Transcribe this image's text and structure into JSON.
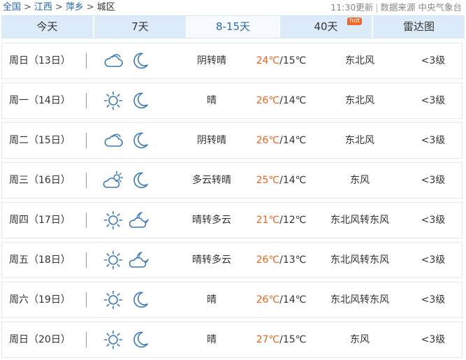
{
  "breadcrumb": {
    "items": [
      "全国",
      "江西",
      "萍乡"
    ],
    "current": "城区",
    "separator": ">"
  },
  "meta": {
    "update_time": "11:30更新",
    "source": "数据来源 中央气象台",
    "divider": "|"
  },
  "tabs": [
    {
      "label": "今天",
      "active": false,
      "badge": ""
    },
    {
      "label": "7天",
      "active": false,
      "badge": ""
    },
    {
      "label": "8-15天",
      "active": true,
      "badge": ""
    },
    {
      "label": "40天",
      "active": false,
      "badge": "hot"
    },
    {
      "label": "雷达图",
      "active": false,
      "badge": ""
    }
  ],
  "colors": {
    "accent": "#2b6db0",
    "high_temp": "#e8641e",
    "icon": "#3a7ab8",
    "badge": "#f06a2c"
  },
  "forecast": [
    {
      "day": "周日（13日）",
      "day_icon": "cloudy-icon",
      "night_icon": "moon-icon",
      "condition": "阴转晴",
      "high": "24℃",
      "low": "/15℃",
      "wind": "东北风",
      "level": "<3级"
    },
    {
      "day": "周一（14日）",
      "day_icon": "sun-icon",
      "night_icon": "moon-icon",
      "condition": "晴",
      "high": "26℃",
      "low": "/14℃",
      "wind": "东北风",
      "level": "<3级"
    },
    {
      "day": "周二（15日）",
      "day_icon": "cloudy-icon",
      "night_icon": "moon-icon",
      "condition": "阴转晴",
      "high": "26℃",
      "low": "/14℃",
      "wind": "东北风",
      "level": "<3级"
    },
    {
      "day": "周三（16日）",
      "day_icon": "partly-cloudy-icon",
      "night_icon": "moon-icon",
      "condition": "多云转晴",
      "high": "25℃",
      "low": "/14℃",
      "wind": "东风",
      "level": "<3级"
    },
    {
      "day": "周四（17日）",
      "day_icon": "sun-icon",
      "night_icon": "cloudy-night-icon",
      "condition": "晴转多云",
      "high": "21℃",
      "low": "/12℃",
      "wind": "东北风转东风",
      "level": "<3级"
    },
    {
      "day": "周五（18日）",
      "day_icon": "sun-icon",
      "night_icon": "cloudy-night-icon",
      "condition": "晴转多云",
      "high": "26℃",
      "low": "/13℃",
      "wind": "东北风转东风",
      "level": "<3级"
    },
    {
      "day": "周六（19日）",
      "day_icon": "sun-icon",
      "night_icon": "moon-icon",
      "condition": "晴",
      "high": "26℃",
      "low": "/14℃",
      "wind": "东北风转东风",
      "level": "<3级"
    },
    {
      "day": "周日（20日）",
      "day_icon": "sun-icon",
      "night_icon": "moon-icon",
      "condition": "晴",
      "high": "27℃",
      "low": "/15℃",
      "wind": "东风",
      "level": "<3级"
    }
  ]
}
